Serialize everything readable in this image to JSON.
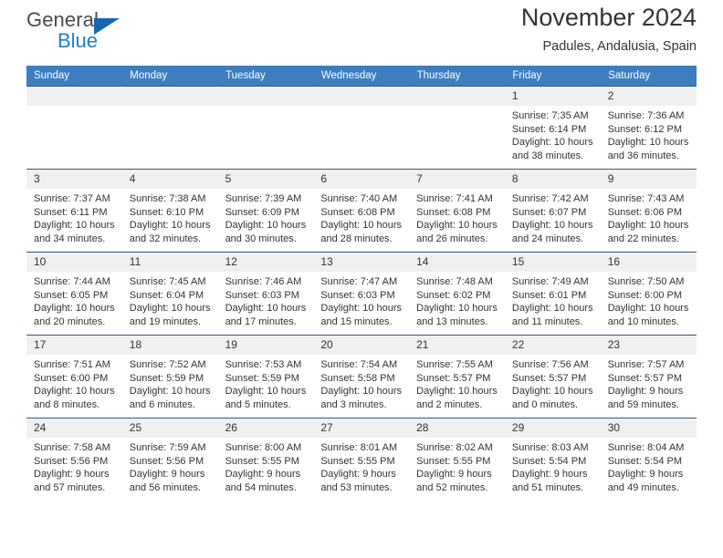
{
  "brand": {
    "name_primary": "General",
    "name_secondary": "Blue",
    "logo_icon": "blue-triangle-icon",
    "primary_color": "#4a4a4a",
    "secondary_color": "#1f7ec9"
  },
  "header": {
    "title": "November 2024",
    "subtitle": "Padules, Andalusia, Spain",
    "header_bg_color": "#3c7ebf",
    "header_text_color": "#ffffff"
  },
  "calendar": {
    "weekday_headers": [
      "Sunday",
      "Monday",
      "Tuesday",
      "Wednesday",
      "Thursday",
      "Friday",
      "Saturday"
    ],
    "labels": {
      "sunrise": "Sunrise:",
      "sunset": "Sunset:",
      "daylight": "Daylight:"
    },
    "weeks": [
      [
        {
          "day": "",
          "blank": true
        },
        {
          "day": "",
          "blank": true
        },
        {
          "day": "",
          "blank": true
        },
        {
          "day": "",
          "blank": true
        },
        {
          "day": "",
          "blank": true
        },
        {
          "day": "1",
          "sunrise": "Sunrise: 7:35 AM",
          "sunset": "Sunset: 6:14 PM",
          "daylight": "Daylight: 10 hours and 38 minutes."
        },
        {
          "day": "2",
          "sunrise": "Sunrise: 7:36 AM",
          "sunset": "Sunset: 6:12 PM",
          "daylight": "Daylight: 10 hours and 36 minutes."
        }
      ],
      [
        {
          "day": "3",
          "sunrise": "Sunrise: 7:37 AM",
          "sunset": "Sunset: 6:11 PM",
          "daylight": "Daylight: 10 hours and 34 minutes."
        },
        {
          "day": "4",
          "sunrise": "Sunrise: 7:38 AM",
          "sunset": "Sunset: 6:10 PM",
          "daylight": "Daylight: 10 hours and 32 minutes."
        },
        {
          "day": "5",
          "sunrise": "Sunrise: 7:39 AM",
          "sunset": "Sunset: 6:09 PM",
          "daylight": "Daylight: 10 hours and 30 minutes."
        },
        {
          "day": "6",
          "sunrise": "Sunrise: 7:40 AM",
          "sunset": "Sunset: 6:08 PM",
          "daylight": "Daylight: 10 hours and 28 minutes."
        },
        {
          "day": "7",
          "sunrise": "Sunrise: 7:41 AM",
          "sunset": "Sunset: 6:08 PM",
          "daylight": "Daylight: 10 hours and 26 minutes."
        },
        {
          "day": "8",
          "sunrise": "Sunrise: 7:42 AM",
          "sunset": "Sunset: 6:07 PM",
          "daylight": "Daylight: 10 hours and 24 minutes."
        },
        {
          "day": "9",
          "sunrise": "Sunrise: 7:43 AM",
          "sunset": "Sunset: 6:06 PM",
          "daylight": "Daylight: 10 hours and 22 minutes."
        }
      ],
      [
        {
          "day": "10",
          "sunrise": "Sunrise: 7:44 AM",
          "sunset": "Sunset: 6:05 PM",
          "daylight": "Daylight: 10 hours and 20 minutes."
        },
        {
          "day": "11",
          "sunrise": "Sunrise: 7:45 AM",
          "sunset": "Sunset: 6:04 PM",
          "daylight": "Daylight: 10 hours and 19 minutes."
        },
        {
          "day": "12",
          "sunrise": "Sunrise: 7:46 AM",
          "sunset": "Sunset: 6:03 PM",
          "daylight": "Daylight: 10 hours and 17 minutes."
        },
        {
          "day": "13",
          "sunrise": "Sunrise: 7:47 AM",
          "sunset": "Sunset: 6:03 PM",
          "daylight": "Daylight: 10 hours and 15 minutes."
        },
        {
          "day": "14",
          "sunrise": "Sunrise: 7:48 AM",
          "sunset": "Sunset: 6:02 PM",
          "daylight": "Daylight: 10 hours and 13 minutes."
        },
        {
          "day": "15",
          "sunrise": "Sunrise: 7:49 AM",
          "sunset": "Sunset: 6:01 PM",
          "daylight": "Daylight: 10 hours and 11 minutes."
        },
        {
          "day": "16",
          "sunrise": "Sunrise: 7:50 AM",
          "sunset": "Sunset: 6:00 PM",
          "daylight": "Daylight: 10 hours and 10 minutes."
        }
      ],
      [
        {
          "day": "17",
          "sunrise": "Sunrise: 7:51 AM",
          "sunset": "Sunset: 6:00 PM",
          "daylight": "Daylight: 10 hours and 8 minutes."
        },
        {
          "day": "18",
          "sunrise": "Sunrise: 7:52 AM",
          "sunset": "Sunset: 5:59 PM",
          "daylight": "Daylight: 10 hours and 6 minutes."
        },
        {
          "day": "19",
          "sunrise": "Sunrise: 7:53 AM",
          "sunset": "Sunset: 5:59 PM",
          "daylight": "Daylight: 10 hours and 5 minutes."
        },
        {
          "day": "20",
          "sunrise": "Sunrise: 7:54 AM",
          "sunset": "Sunset: 5:58 PM",
          "daylight": "Daylight: 10 hours and 3 minutes."
        },
        {
          "day": "21",
          "sunrise": "Sunrise: 7:55 AM",
          "sunset": "Sunset: 5:57 PM",
          "daylight": "Daylight: 10 hours and 2 minutes."
        },
        {
          "day": "22",
          "sunrise": "Sunrise: 7:56 AM",
          "sunset": "Sunset: 5:57 PM",
          "daylight": "Daylight: 10 hours and 0 minutes."
        },
        {
          "day": "23",
          "sunrise": "Sunrise: 7:57 AM",
          "sunset": "Sunset: 5:57 PM",
          "daylight": "Daylight: 9 hours and 59 minutes."
        }
      ],
      [
        {
          "day": "24",
          "sunrise": "Sunrise: 7:58 AM",
          "sunset": "Sunset: 5:56 PM",
          "daylight": "Daylight: 9 hours and 57 minutes."
        },
        {
          "day": "25",
          "sunrise": "Sunrise: 7:59 AM",
          "sunset": "Sunset: 5:56 PM",
          "daylight": "Daylight: 9 hours and 56 minutes."
        },
        {
          "day": "26",
          "sunrise": "Sunrise: 8:00 AM",
          "sunset": "Sunset: 5:55 PM",
          "daylight": "Daylight: 9 hours and 54 minutes."
        },
        {
          "day": "27",
          "sunrise": "Sunrise: 8:01 AM",
          "sunset": "Sunset: 5:55 PM",
          "daylight": "Daylight: 9 hours and 53 minutes."
        },
        {
          "day": "28",
          "sunrise": "Sunrise: 8:02 AM",
          "sunset": "Sunset: 5:55 PM",
          "daylight": "Daylight: 9 hours and 52 minutes."
        },
        {
          "day": "29",
          "sunrise": "Sunrise: 8:03 AM",
          "sunset": "Sunset: 5:54 PM",
          "daylight": "Daylight: 9 hours and 51 minutes."
        },
        {
          "day": "30",
          "sunrise": "Sunrise: 8:04 AM",
          "sunset": "Sunset: 5:54 PM",
          "daylight": "Daylight: 9 hours and 49 minutes."
        }
      ]
    ]
  }
}
